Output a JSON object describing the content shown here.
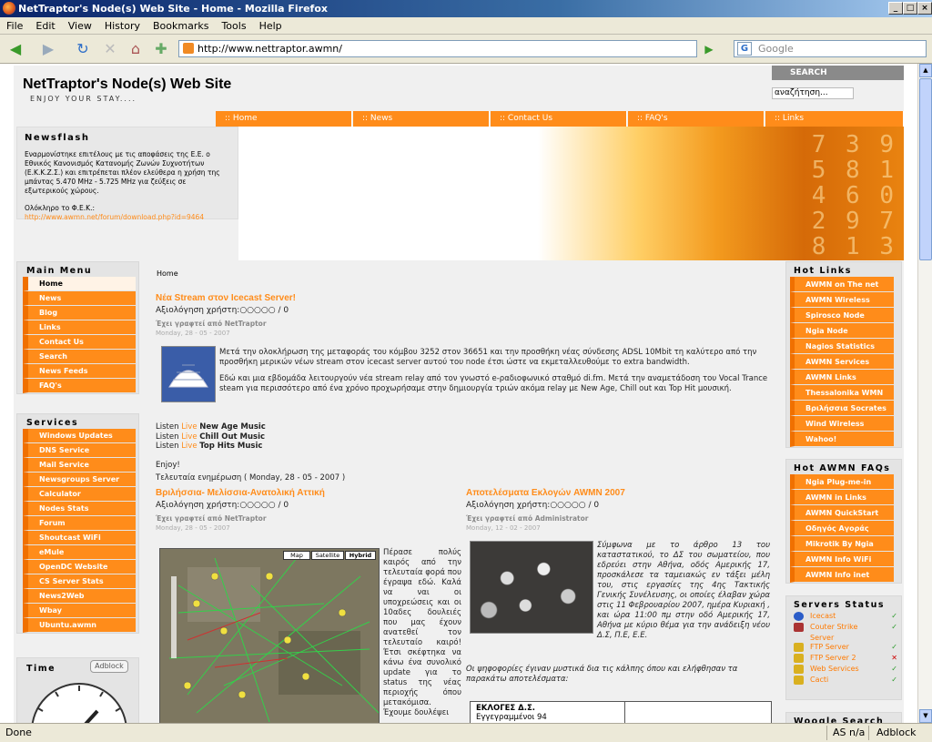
{
  "browser": {
    "title": "NetTraptor's Node(s) Web Site - Home - Mozilla Firefox",
    "menu": [
      "File",
      "Edit",
      "View",
      "History",
      "Bookmarks",
      "Tools",
      "Help"
    ],
    "url": "http://www.nettraptor.awmn/",
    "search_placeholder": "Google",
    "status": "Done",
    "status_right": [
      "AS n/a",
      "Adblock"
    ]
  },
  "site": {
    "title": "NetTraptor's Node(s) Web Site",
    "subtitle": "ENJOY YOUR STAY....",
    "search_label": "SEARCH",
    "search_placeholder": "αναζήτηση...",
    "topnav": [
      ":: Home",
      ":: News",
      ":: Contact Us",
      ":: FAQ's",
      ":: Links"
    ]
  },
  "newsflash": {
    "title": "Newsflash",
    "text": "Εναρμονίστηκε επιτέλους με τις αποφάσεις της Ε.Ε. ο Εθνικός Κανονισμός Κατανομής Ζωνών Συχνοτήτων (Ε.Κ.Κ.Ζ.Σ.) και επιτρέπεται πλέον ελεύθερα η χρήση της μπάντας 5.470 MHz - 5.725 MHz για ζεύξεις σε εξωτερικούς χώρους.",
    "text2": "Ολόκληρο το Φ.Ε.Κ.:",
    "link": "http://www.awmn.net/forum/download.php?id=9464"
  },
  "main_menu": {
    "title": "Main Menu",
    "items": [
      "Home",
      "News",
      "Blog",
      "Links",
      "Contact Us",
      "Search",
      "News Feeds",
      "FAQ's"
    ]
  },
  "services": {
    "title": "Services",
    "items": [
      "Windows Updates",
      "DNS Service",
      "Mail Service",
      "Newsgroups Server",
      "Calculator",
      "Nodes Stats",
      "Forum",
      "Shoutcast WiFi",
      "eMule",
      "OpenDC Website",
      "CS Server Stats",
      "News2Web",
      "Wbay",
      "Ubuntu.awmn"
    ]
  },
  "time_box": {
    "title": "Time",
    "adblock": "Adblock"
  },
  "hot_links": {
    "title": "Hot Links",
    "items": [
      "AWMN on The net",
      "AWMN Wireless",
      "Spirosco Node",
      "Ngia Node",
      "Nagios Statistics",
      "AWMN Services",
      "AWMN Links",
      "Thessalonika WMN",
      "Βριλήσσια Socrates",
      "Wind Wireless",
      "Wahoo!"
    ]
  },
  "hot_faqs": {
    "title": "Hot AWMN FAQs",
    "items": [
      "Ngia Plug-me-in",
      "AWMN in Links",
      "AWMN QuickStart",
      "Οδηγός Αγοράς",
      "Mikrotik By Ngia",
      "AWMN Info WiFi",
      "AWMN Info inet"
    ]
  },
  "servers": {
    "title": "Servers Status",
    "items": [
      {
        "name": "Icecast",
        "status": "✓",
        "color": "#2a9a2a"
      },
      {
        "name": "Couter Strike",
        "name2": "Server",
        "status": "✓",
        "color": "#2a9a2a"
      },
      {
        "name": "FTP Server",
        "status": "✓",
        "color": "#2a9a2a"
      },
      {
        "name": "FTP Server 2",
        "status": "✕",
        "color": "#cc0000"
      },
      {
        "name": "Web Services",
        "status": "✓",
        "color": "#2a9a2a"
      },
      {
        "name": "Cacti",
        "status": "✓",
        "color": "#2a9a2a"
      }
    ],
    "next_title": "Woogle Search"
  },
  "content": {
    "breadcrumb": "Home",
    "post1": {
      "title": "Νέα Stream στον Icecast Server!",
      "rating": "Αξιολόγηση χρήστη:○○○○○ / 0",
      "author": "Έχει γραφτεί από NetTraptor",
      "date": "Monday, 28 - 05 - 2007",
      "p1": "Μετά την ολοκλήρωση της μεταφοράς του κόμβου 3252 στον 36651 και την προσθήκη νέας σύνδεσης ADSL 10Mbit τη καλύτερο από την προσθήκη μερικών νέων stream στον icecast server αυτού του node έτσι ώστε να εκμεταλλευθούμε το extra bandwidth.",
      "p2": "Εδώ και μια εβδομάδα λειτουργούν νέα stream relay από τον γνωστό e-ραδιοφωνικό σταθμό di.fm. Μετά την αναμετάδοση του Vocal Trance steam για περισσότερο από ένα χρόνο προχωρήσαμε στην δημιουργία τριών ακόμα relay με New Age, Chill out και Top Hit μουσική.",
      "listen_word": "Listen",
      "live_word": "Live",
      "l1": "New Age Music",
      "l2": "Chill Out Music",
      "l3": "Top Hits Music",
      "enjoy": "Enjoy!",
      "updated": "Τελευταία ενημέρωση ( Monday, 28 - 05 - 2007 )"
    },
    "post2": {
      "title": "Βριλήσσια- Μελίσσια-Ανατολική Αττική",
      "rating": "Αξιολόγηση χρήστη:○○○○○ / 0",
      "author": "Έχει γραφτεί από NetTraptor",
      "date": "Monday, 28 - 05 - 2007",
      "map_buttons": [
        "Map",
        "Satellite",
        "Hybrid"
      ],
      "text": "Πέρασε πολύς καιρός από την τελευταία φορά που έγραψα εδώ. Καλά να ναι οι υποχρεώσεις και οι 10αδες δουλειές που μας έχουν ανατεθεί τον τελευταίο καιρό! Έτσι σκέφτηκα να κάνω ένα συνολικό update για το status της νέας περιοχής όπου μετακόμισα. Έχουμε δουλέψει"
    },
    "post3": {
      "title": "Αποτελέσματα Εκλογών AWMN 2007",
      "rating": "Αξιολόγηση χρήστη:○○○○○ / 0",
      "author": "Έχει γραφτεί από Administrator",
      "date": "Monday, 12 - 02 - 2007",
      "text": "Σύμφωνα με το άρθρο 13 του καταστατικού, το ΔΣ του σωματείου, που εδρεύει στην Αθήνα, οδός Αμερικής 17, προσκάλεσε τα ταμειακώς εν τάξει μέλη του, στις εργασίες της 4ης Τακτικής Γενικής Συνέλευσης, οι οποίες έλαβαν χώρα στις 11 Φεβρουαρίου 2007, ημέρα Κυριακή , και ώρα 11:00 πμ στην οδό Αμερικής 17, Αθήνα με κύριο θέμα για την ανάδειξη νέου Δ.Σ, Π.Ε, Ε.Ε.",
      "text2": "Οι ψηφοφορίες έγιναν μυστικά δια τις κάλπης όπου και ελήφθησαν τα παρακάτω αποτελέσματα:",
      "table_head": "ΕΚΛΟΓΕΣ Δ.Σ.",
      "table_row": "Εγγεγραμμένοι 94"
    }
  }
}
